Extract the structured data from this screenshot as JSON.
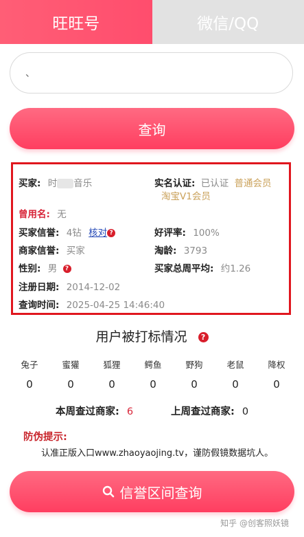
{
  "tabs": {
    "active": "旺旺号",
    "inactive": "微信/QQ"
  },
  "input": {
    "value": "、"
  },
  "query_button": "查询",
  "result": {
    "buyer_label": "买家:",
    "buyer_value_a": "时",
    "buyer_value_b": "音乐",
    "realname_label": "实名认证:",
    "realname_value": "已认证",
    "member_level": "普通会员",
    "taobao_level": "淘宝V1会员",
    "old_name_label": "曾用名:",
    "old_name_value": "无",
    "buyer_credit_label": "买家信誉:",
    "buyer_credit_value": "4钻",
    "verify_link": "核对",
    "good_rate_label": "好评率:",
    "good_rate_value": "100%",
    "seller_credit_label": "商家信誉:",
    "seller_credit_value": "买家",
    "taobao_age_label": "淘龄:",
    "taobao_age_value": "3793",
    "gender_label": "性别:",
    "gender_value": "男",
    "weekly_avg_label": "买家总周平均:",
    "weekly_avg_value": "约1.26",
    "register_label": "注册日期:",
    "register_value": "2014-12-02",
    "query_time_label": "查询时间:",
    "query_time_value": "2025-04-25 14:46:40"
  },
  "tagging": {
    "title": "用户被打标情况",
    "categories": [
      "兔子",
      "蜜獾",
      "狐狸",
      "鳄鱼",
      "野狗",
      "老鼠",
      "降权"
    ],
    "counts": [
      "0",
      "0",
      "0",
      "0",
      "0",
      "0",
      "0"
    ]
  },
  "merchant": {
    "this_week_label": "本周查过商家:",
    "this_week_value": "6",
    "last_week_label": "上周查过商家:",
    "last_week_value": "0"
  },
  "warning": {
    "title": "防伪提示:",
    "text": "认准正版入口www.zhaoyaojing.tv，谨防假镜数据坑人。"
  },
  "credit_range_button": "信誉区间查询",
  "watermark": "知乎 @创客照妖镜",
  "colors": {
    "accent": "#ff4d6d",
    "red_border": "#e0161e",
    "gold": "#caa15a"
  }
}
